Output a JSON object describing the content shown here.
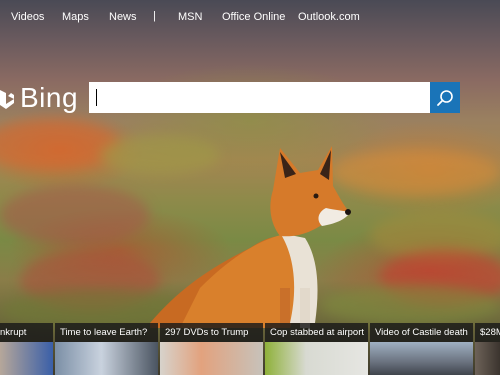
{
  "nav": {
    "items": [
      "Videos",
      "Maps",
      "News",
      "|",
      "MSN",
      "Office Online",
      "Outlook.com"
    ]
  },
  "logo": {
    "text": "Bing"
  },
  "search": {
    "value": "",
    "placeholder": "",
    "button_icon": "search-icon"
  },
  "news": [
    {
      "title": "nkrupt"
    },
    {
      "title": "Time to leave Earth?"
    },
    {
      "title": "297 DVDs to Trump"
    },
    {
      "title": "Cop stabbed at airport"
    },
    {
      "title": "Video of Castile death"
    },
    {
      "title": "$28M"
    }
  ],
  "colors": {
    "search_button": "#1a74b8",
    "strip_bg": "#191919"
  }
}
